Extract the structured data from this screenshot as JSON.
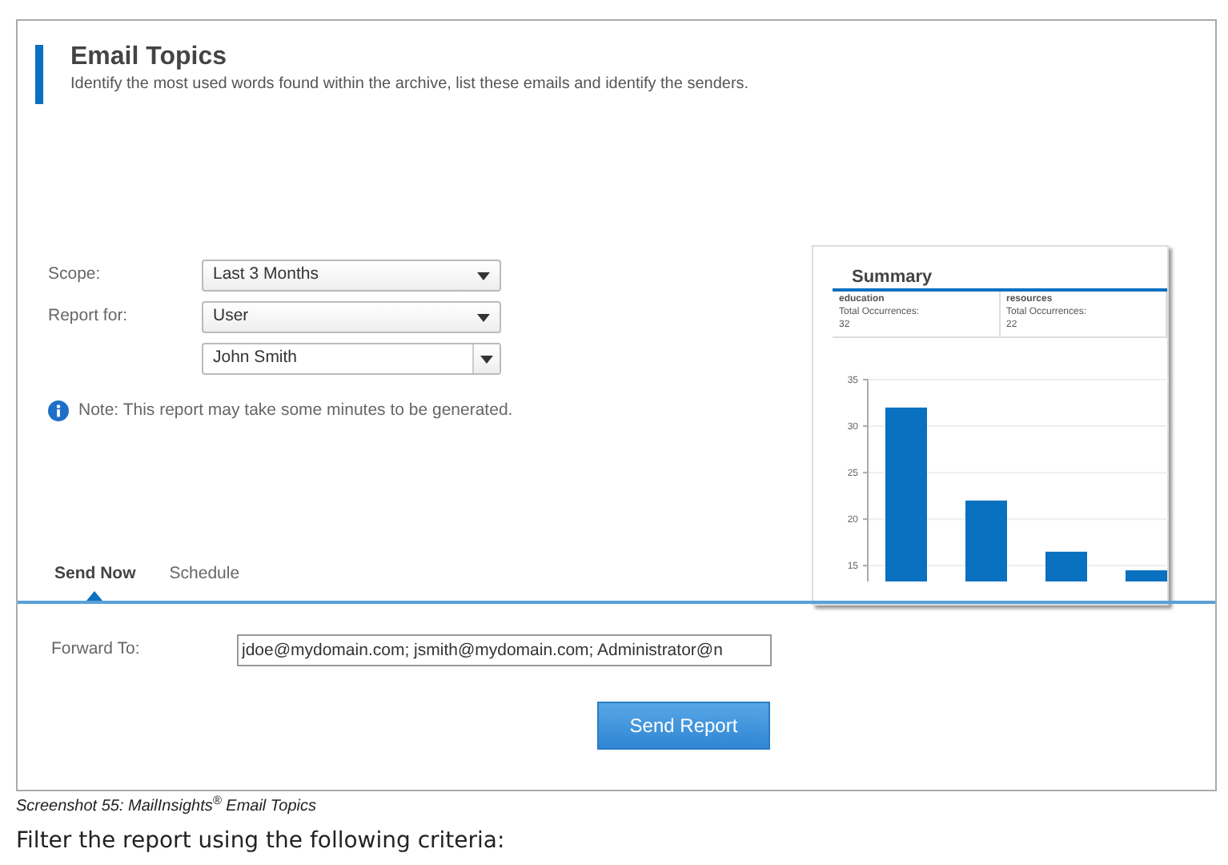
{
  "header": {
    "title": "Email Topics",
    "subtitle": "Identify the most used words found within the archive, list these emails and identify the senders."
  },
  "form": {
    "fields": [
      {
        "label": "Scope:",
        "value": "Last 3 Months",
        "kind": "select"
      },
      {
        "label": "Report for:",
        "value": "User",
        "kind": "select"
      },
      {
        "value": "John Smith",
        "kind": "combo"
      }
    ],
    "note": "Note: This report may take some minutes to be generated."
  },
  "summary": {
    "title": "Summary",
    "topics": [
      {
        "word": "education",
        "label": "Total Occurrences:",
        "count": "32"
      },
      {
        "word": "resources",
        "label": "Total Occurrences:",
        "count": "22"
      }
    ],
    "chart_data": {
      "type": "bar",
      "grid": true,
      "ylim": [
        13.3,
        35
      ],
      "yticks": [
        15,
        20,
        25,
        30,
        35
      ],
      "series": [
        {
          "color": "#0a70c0",
          "values": [
            32,
            22,
            16.5,
            14.5
          ]
        }
      ]
    }
  },
  "tabs": [
    {
      "label": "Send Now",
      "selected": true
    },
    {
      "label": "Schedule",
      "selected": false
    }
  ],
  "forward": {
    "label": "Forward To:",
    "value": "jdoe@mydomain.com; jsmith@mydomain.com; Administrator@n"
  },
  "send_button": "Send Report",
  "caption": "Screenshot 55: MailInsights$^{®}$ Email Topics",
  "body_text": "Filter the report using the following criteria:"
}
